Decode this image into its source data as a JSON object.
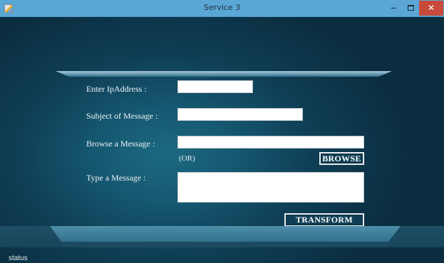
{
  "window": {
    "title": "Service 3",
    "minimize_glyph": "–",
    "close_glyph": "✕",
    "icon": "app-icon"
  },
  "form": {
    "ip_label": "Enter IpAddress :",
    "ip_value": "",
    "subject_label": "Subject of Message :",
    "subject_value": "",
    "browse_label": "Browse a Message :",
    "browse_value": "",
    "or_text": "(OR)",
    "browse_button": "BROWSE",
    "type_label": "Type a Message :",
    "message_value": "",
    "transform_button": "TRANSFORM"
  },
  "status": {
    "text": "status"
  },
  "colors": {
    "titlebar": "#5aa7d6",
    "close": "#c74a3a",
    "background": "#155770"
  }
}
